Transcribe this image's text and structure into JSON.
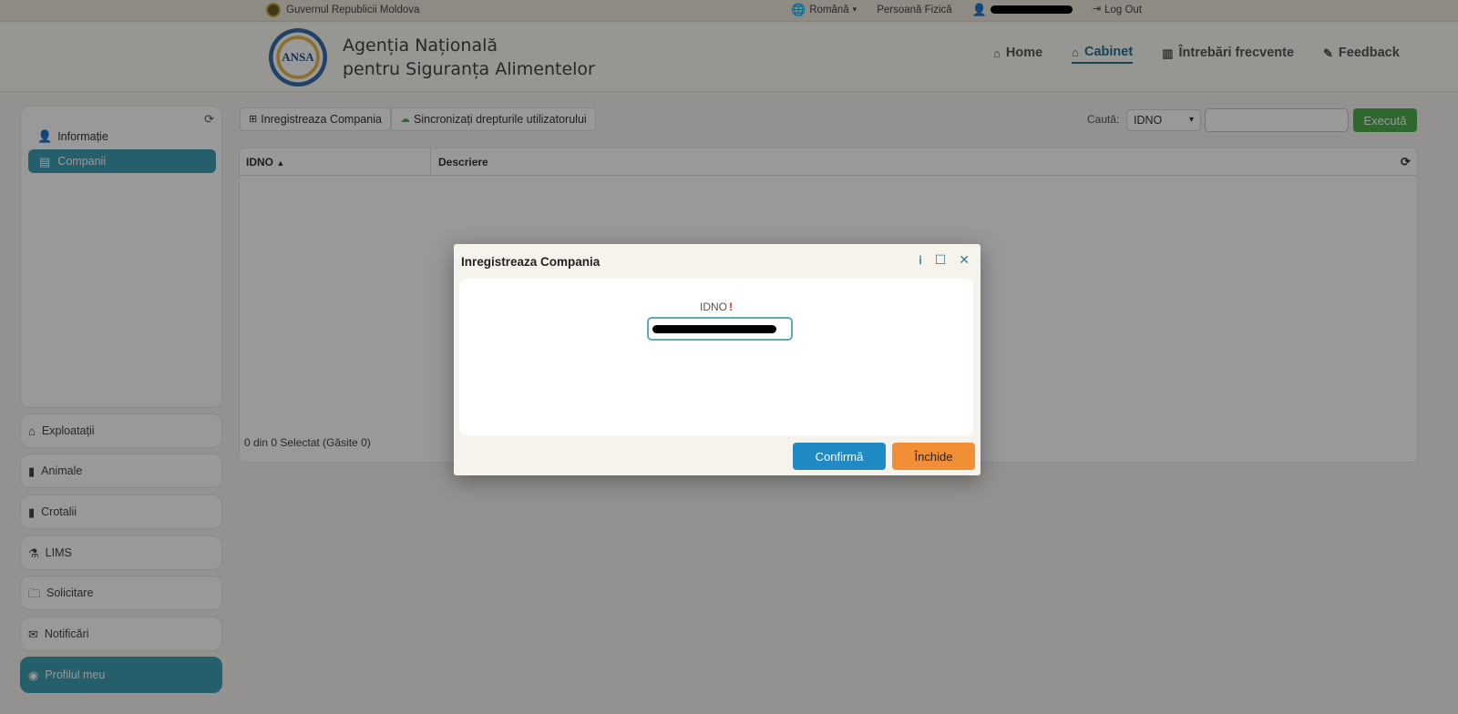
{
  "topbar": {
    "government": "Guvernul Republicii Moldova",
    "language": "Română",
    "role": "Persoană Fizică",
    "logout": "Log Out"
  },
  "header": {
    "agency_line1": "Agenția Națională",
    "agency_line2": "pentru Siguranța Alimentelor",
    "logo_text": "ANSA",
    "nav": [
      {
        "label": "Home",
        "icon": "home-icon"
      },
      {
        "label": "Cabinet",
        "icon": "home-icon",
        "active": true
      },
      {
        "label": "Întrebări frecvente",
        "icon": "books-icon"
      },
      {
        "label": "Feedback",
        "icon": "edit-icon"
      }
    ]
  },
  "sidebar": {
    "panel": {
      "info": "Informație",
      "companies": "Companii"
    },
    "items": [
      {
        "label": "Exploatații",
        "icon": "home-icon"
      },
      {
        "label": "Animale",
        "icon": "file-icon"
      },
      {
        "label": "Crotalii",
        "icon": "bookmark-icon"
      },
      {
        "label": "LIMS",
        "icon": "flask-icon"
      },
      {
        "label": "Solicitare",
        "icon": "folder-icon"
      },
      {
        "label": "Notificări",
        "icon": "envelope-icon"
      },
      {
        "label": "Profilul meu",
        "icon": "user-circle-icon",
        "active": true
      }
    ]
  },
  "toolbar": {
    "register": "Inregistreaza Compania",
    "sync": "Sincronizați drepturile utilizatorului",
    "search_label": "Caută:",
    "search_field": "IDNO",
    "search_value": "",
    "execute": "Execută"
  },
  "grid": {
    "col1": "IDNO",
    "col2": "Descriere",
    "footer": "0 din 0 Selectat (Găsite 0)"
  },
  "modal": {
    "title": "Inregistreaza Compania",
    "field_label": "IDNO",
    "required_mark": "!",
    "confirm": "Confirmă",
    "close": "Închide"
  },
  "colors": {
    "accent": "#3d9fb3",
    "execute": "#4cae4c",
    "confirm": "#1f8ac4",
    "close": "#f28f36"
  }
}
